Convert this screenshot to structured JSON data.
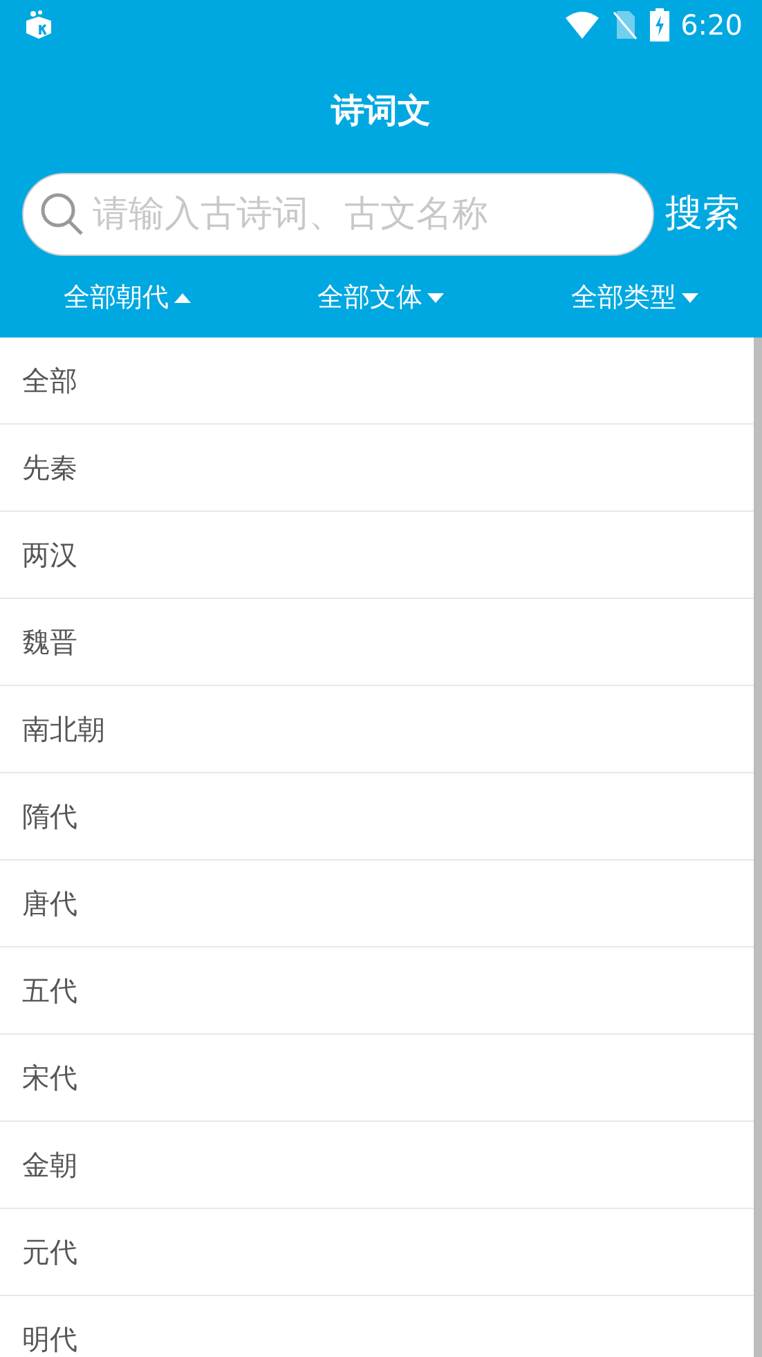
{
  "status_bar": {
    "time": "6:20"
  },
  "title": "诗词文",
  "search": {
    "placeholder": "请输入古诗词、古文名称",
    "button": "搜索"
  },
  "filters": [
    {
      "label": "全部朝代",
      "expanded": true
    },
    {
      "label": "全部文体",
      "expanded": false
    },
    {
      "label": "全部类型",
      "expanded": false
    }
  ],
  "dynasties": [
    "全部",
    "先秦",
    "两汉",
    "魏晋",
    "南北朝",
    "隋代",
    "唐代",
    "五代",
    "宋代",
    "金朝",
    "元代",
    "明代"
  ]
}
